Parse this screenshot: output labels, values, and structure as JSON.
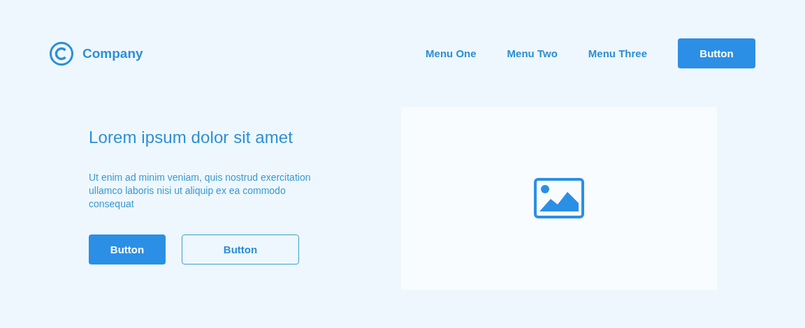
{
  "brand": {
    "name": "Company"
  },
  "nav": {
    "items": [
      "Menu One",
      "Menu Two",
      "Menu Three"
    ],
    "button": "Button"
  },
  "hero": {
    "title": "Lorem ipsum dolor sit amet",
    "text": "Ut enim ad minim veniam, quis nostrud exercitation ullamco laboris nisi ut aliquip ex ea commodo consequat",
    "buttons": [
      {
        "label": "Button",
        "kind": "primary"
      },
      {
        "label": "Button",
        "kind": "outline"
      }
    ]
  }
}
